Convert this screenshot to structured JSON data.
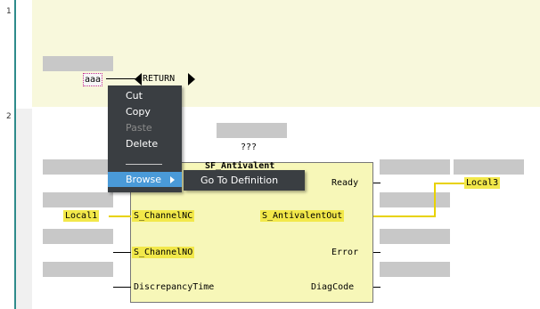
{
  "editor": {
    "rung_numbers": [
      "1",
      "2"
    ],
    "rung1": {
      "variable": "aaa",
      "return_label": "RETURN"
    },
    "rung2": {
      "instance_name": "???",
      "block_type": "SF_Antivalent",
      "inputs": [
        "S_ChannelNC",
        "S_ChannelNO",
        "DiscrepancyTime"
      ],
      "outputs": [
        "Ready",
        "S_AntivalentOut",
        "Error",
        "DiagCode"
      ],
      "input_var": "Local1",
      "output_var": "Local3"
    }
  },
  "context_menu": {
    "items": [
      {
        "label": "Cut",
        "mnemonic": "t",
        "enabled": true
      },
      {
        "label": "Copy",
        "mnemonic": "C",
        "enabled": true
      },
      {
        "label": "Paste",
        "mnemonic": "P",
        "enabled": false
      },
      {
        "label": "Delete",
        "mnemonic": "D",
        "enabled": true
      }
    ],
    "browse_label": "Browse",
    "browse_mnemonic": "e",
    "submenu": {
      "go_to_definition": "Go To Definition",
      "go_mnemonic": "G"
    }
  },
  "colors": {
    "rung1_bg": "#f8f8dc",
    "fb_bg": "#f7f7b8",
    "highlight": "#f2e84a",
    "menu_bg": "#3a3e42",
    "menu_selected": "#4a9ad8"
  }
}
